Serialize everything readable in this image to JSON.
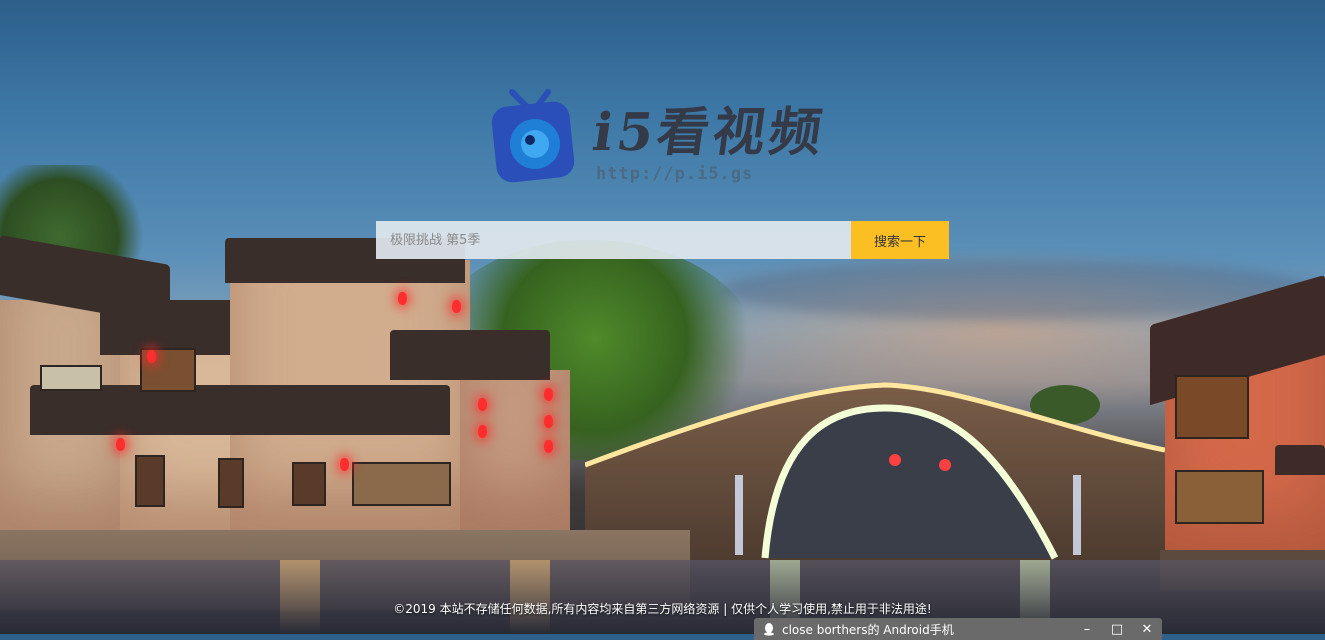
{
  "logo": {
    "title": "i5看视频",
    "url": "http://p.i5.gs"
  },
  "search": {
    "placeholder": "极限挑战 第5季",
    "button_label": "搜索一下"
  },
  "footer": {
    "text": "©2019 本站不存储任何数据,所有内容均来自第三方网络资源 | 仅供个人学习使用,禁止用于非法用途!"
  },
  "notification": {
    "text": "close borthers的 Android手机",
    "icons": [
      "qq-icon",
      "minimize-icon",
      "maximize-icon",
      "close-icon"
    ]
  },
  "colors": {
    "accent": "#fbbf24",
    "logo_blue": "#2a4fb8"
  }
}
